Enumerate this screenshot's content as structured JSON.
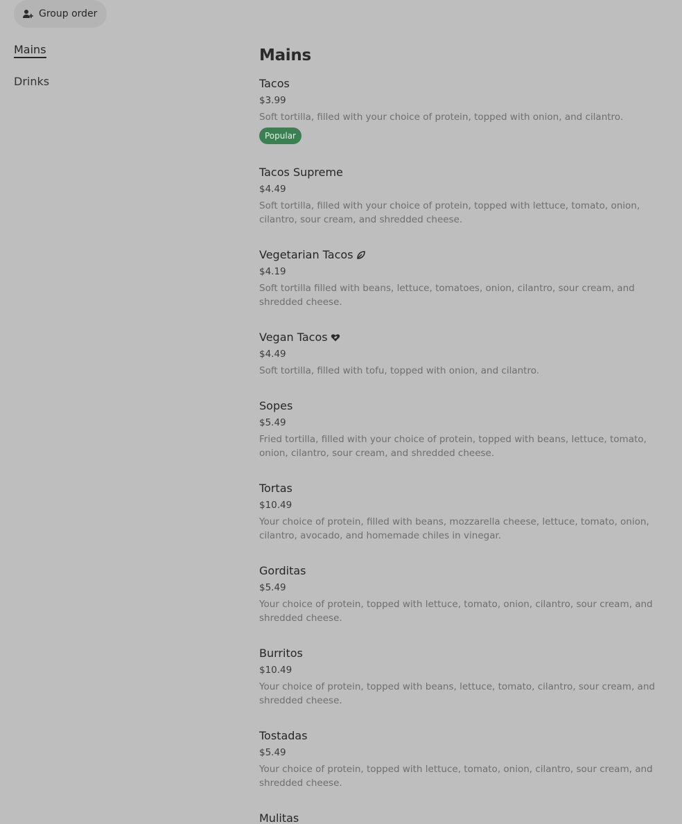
{
  "header": {
    "group_order_label": "Group order"
  },
  "sidebar": {
    "items": [
      {
        "label": "Mains"
      },
      {
        "label": "Drinks"
      }
    ]
  },
  "section": {
    "title": "Mains"
  },
  "items": [
    {
      "name": "Tacos",
      "price": "$3.99",
      "description": "Soft tortilla, filled with your choice of protein, topped with onion, and cilantro.",
      "badge": "Popular"
    },
    {
      "name": "Tacos Supreme",
      "price": "$4.49",
      "description": "Soft tortilla, filled with your choice of protein, topped with lettuce, tomato, onion, cilantro, sour cream, and shredded cheese."
    },
    {
      "name": "Vegetarian Tacos",
      "price": "$4.19",
      "description": "Soft tortilla filled with beans, lettuce, tomatoes, onion, cilantro, sour cream, and shredded cheese.",
      "icon": "leaf-icon"
    },
    {
      "name": "Vegan Tacos",
      "price": "$4.49",
      "description": "Soft tortilla, filled with tofu, topped with onion, and cilantro.",
      "icon": "heart-leaf-icon"
    },
    {
      "name": "Sopes",
      "price": "$5.49",
      "description": "Fried tortilla, filled with your choice of protein, topped with beans, lettuce, tomato, onion, cilantro, sour cream, and shredded cheese."
    },
    {
      "name": "Tortas",
      "price": "$10.49",
      "description": "Your choice of protein, filled with beans, mozzarella cheese, lettuce, tomato, onion, cilantro, avocado, and homemade chiles in vinegar."
    },
    {
      "name": "Gorditas",
      "price": "$5.49",
      "description": "Your choice of protein, topped with lettuce, tomato, onion, cilantro, sour cream, and shredded cheese."
    },
    {
      "name": "Burritos",
      "price": "$10.49",
      "description": "Your choice of protein, topped with beans, lettuce, tomato, cilantro, sour cream, and shredded cheese."
    },
    {
      "name": "Tostadas",
      "price": "$5.49",
      "description": "Your choice of protein, topped with lettuce, tomato, onion, cilantro, sour cream, and shredded cheese."
    },
    {
      "name": "Mulitas"
    }
  ],
  "colors": {
    "background": "#bebebe",
    "popular_badge": "#3b7f53"
  }
}
